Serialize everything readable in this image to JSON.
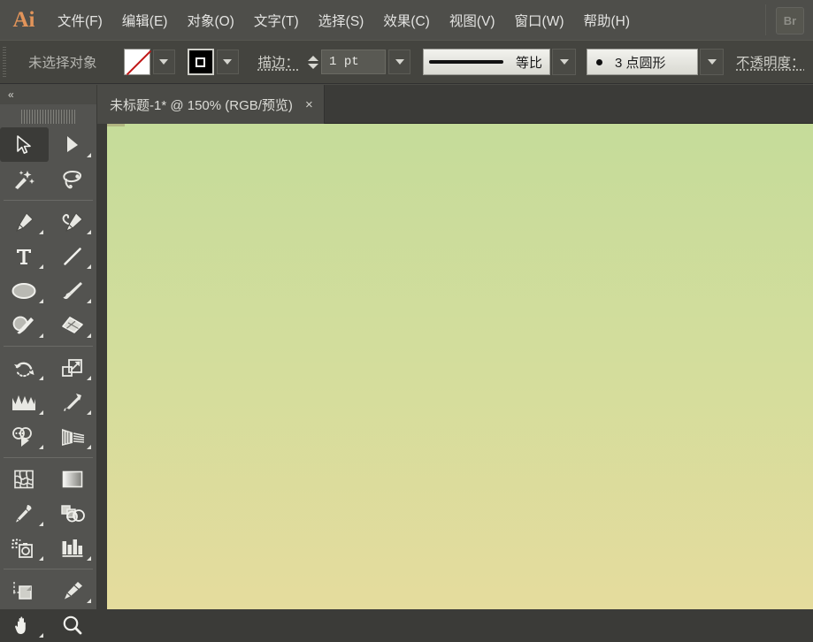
{
  "app": {
    "name": "Adobe Illustrator",
    "logo_text": "Ai",
    "bridge_button_label": "Br"
  },
  "menubar": {
    "items": [
      {
        "label": "文件(F)",
        "name": "menu-file"
      },
      {
        "label": "编辑(E)",
        "name": "menu-edit"
      },
      {
        "label": "对象(O)",
        "name": "menu-object"
      },
      {
        "label": "文字(T)",
        "name": "menu-type"
      },
      {
        "label": "选择(S)",
        "name": "menu-select"
      },
      {
        "label": "效果(C)",
        "name": "menu-effect"
      },
      {
        "label": "视图(V)",
        "name": "menu-view"
      },
      {
        "label": "窗口(W)",
        "name": "menu-window"
      },
      {
        "label": "帮助(H)",
        "name": "menu-help"
      }
    ]
  },
  "controlbar": {
    "selection_status": "未选择对象",
    "fill_swatch": "none",
    "stroke_swatch": "black",
    "stroke_label": "描边：",
    "stroke_weight": "1 pt",
    "stroke_profile": "等比",
    "brush_definition": "3 点圆形",
    "opacity_label": "不透明度："
  },
  "toolbar": {
    "collapse_label": "«",
    "tools": [
      {
        "name": "selection-tool",
        "label": "选择工具",
        "active": true,
        "flyout": false
      },
      {
        "name": "direct-selection-tool",
        "label": "直接选择工具",
        "active": false,
        "flyout": true
      },
      {
        "name": "magic-wand-tool",
        "label": "魔棒工具",
        "active": false,
        "flyout": false
      },
      {
        "name": "lasso-tool",
        "label": "套索工具",
        "active": false,
        "flyout": false
      },
      {
        "name": "pen-tool",
        "label": "钢笔工具",
        "active": false,
        "flyout": true
      },
      {
        "name": "add-anchor-point-tool",
        "label": "添加锚点工具",
        "active": false,
        "flyout": true
      },
      {
        "name": "type-tool",
        "label": "文字工具",
        "active": false,
        "flyout": true
      },
      {
        "name": "line-segment-tool",
        "label": "直线段工具",
        "active": false,
        "flyout": true
      },
      {
        "name": "ellipse-tool",
        "label": "椭圆工具",
        "active": false,
        "flyout": true
      },
      {
        "name": "paintbrush-tool",
        "label": "画笔工具",
        "active": false,
        "flyout": true
      },
      {
        "name": "blob-brush-tool",
        "label": "斑点画笔工具",
        "active": false,
        "flyout": true
      },
      {
        "name": "eraser-tool",
        "label": "橡皮擦工具",
        "active": false,
        "flyout": true
      },
      {
        "name": "rotate-tool",
        "label": "旋转工具",
        "active": false,
        "flyout": true
      },
      {
        "name": "scale-tool",
        "label": "比例缩放工具",
        "active": false,
        "flyout": true
      },
      {
        "name": "width-tool",
        "label": "宽度工具",
        "active": false,
        "flyout": true
      },
      {
        "name": "free-transform-tool",
        "label": "自由变换工具",
        "active": false,
        "flyout": true
      },
      {
        "name": "shape-builder-tool",
        "label": "形状生成器工具",
        "active": false,
        "flyout": true
      },
      {
        "name": "perspective-grid-tool",
        "label": "透视网格工具",
        "active": false,
        "flyout": true
      },
      {
        "name": "mesh-tool",
        "label": "网格工具",
        "active": false,
        "flyout": false
      },
      {
        "name": "gradient-tool",
        "label": "渐变工具",
        "active": false,
        "flyout": false
      },
      {
        "name": "eyedropper-tool",
        "label": "吸管工具",
        "active": false,
        "flyout": true
      },
      {
        "name": "blend-tool",
        "label": "混合工具",
        "active": false,
        "flyout": false
      },
      {
        "name": "symbol-sprayer-tool",
        "label": "符号喷枪工具",
        "active": false,
        "flyout": true
      },
      {
        "name": "column-graph-tool",
        "label": "柱形图工具",
        "active": false,
        "flyout": true
      },
      {
        "name": "artboard-tool",
        "label": "画板工具",
        "active": false,
        "flyout": false
      },
      {
        "name": "slice-tool",
        "label": "切片工具",
        "active": false,
        "flyout": true
      },
      {
        "name": "hand-tool",
        "label": "抓手工具",
        "active": false,
        "flyout": true
      },
      {
        "name": "zoom-tool",
        "label": "缩放工具",
        "active": false,
        "flyout": false
      }
    ]
  },
  "document": {
    "tab_title": "未标题-1* @ 150% (RGB/预览)",
    "close_label": "×",
    "zoom_level": "150%",
    "color_mode": "RGB",
    "view_mode": "预览",
    "modified": true
  },
  "canvas": {
    "gradient_top": "#c5dc9a",
    "gradient_mid": "#d3dd9c",
    "gradient_bottom": "#e5dc9d"
  },
  "colors": {
    "menubar_bg": "#4e4e4a",
    "controlbar_bg": "#44443f",
    "toolbar_bg": "#535350",
    "canvas_bg": "#3b3b38",
    "accent_logo": "#e2945a",
    "fill_none_slash": "#c01616"
  }
}
